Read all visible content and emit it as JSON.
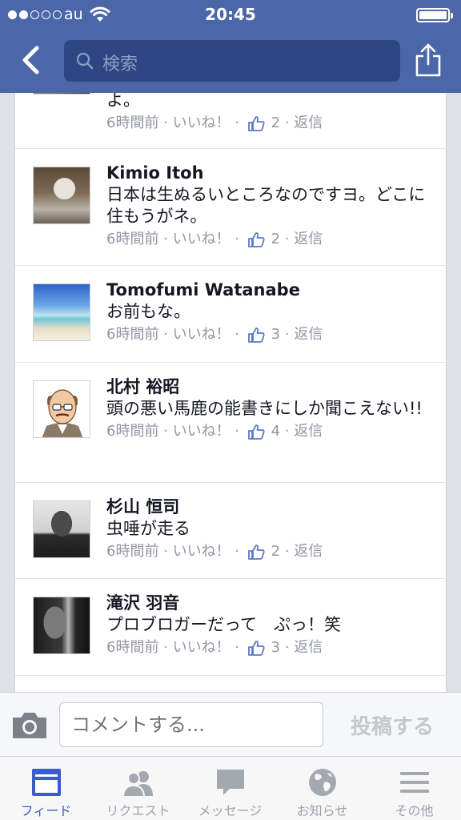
{
  "status_bar": {
    "carrier": "au",
    "time": "20:45"
  },
  "nav": {
    "search_placeholder": "検索"
  },
  "comments": [
    {
      "name": "",
      "text": "よ。",
      "time": "6時間前",
      "like_label": "いいね！",
      "likes": "2",
      "reply_label": "返信"
    },
    {
      "name": "Kimio  Itoh",
      "text": "日本は生ぬるいところなのですヨ。どこに住もうがネ。",
      "time": "6時間前",
      "like_label": "いいね！",
      "likes": "2",
      "reply_label": "返信"
    },
    {
      "name": "Tomofumi Watanabe",
      "text": "お前もな。",
      "time": "6時間前",
      "like_label": "いいね！",
      "likes": "3",
      "reply_label": "返信"
    },
    {
      "name": "北村 裕昭",
      "text": "頭の悪い馬鹿の能書きにしか聞こえない!!",
      "time": "6時間前",
      "like_label": "いいね！",
      "likes": "4",
      "reply_label": "返信"
    },
    {
      "name": "杉山 恒司",
      "text": "虫唾が走る",
      "time": "6時間前",
      "like_label": "いいね！",
      "likes": "2",
      "reply_label": "返信"
    },
    {
      "name": "滝沢 羽音",
      "text": "プロブロガーだって　ぷっ！笑",
      "time": "6時間前",
      "like_label": "いいね！",
      "likes": "3",
      "reply_label": "返信"
    }
  ],
  "composer": {
    "placeholder": "コメントする...",
    "post_label": "投稿する"
  },
  "tabs": [
    {
      "label": "フィード",
      "icon": "feed-icon",
      "active": true
    },
    {
      "label": "リクエスト",
      "icon": "friend-requests-icon",
      "active": false
    },
    {
      "label": "メッセージ",
      "icon": "messages-icon",
      "active": false
    },
    {
      "label": "お知らせ",
      "icon": "globe-notifications-icon",
      "active": false
    },
    {
      "label": "その他",
      "icon": "menu-icon",
      "active": false
    }
  ],
  "colors": {
    "header": "#4b67a8",
    "search_field": "#2e4784",
    "active_tab": "#3b5ccc",
    "meta_text": "#9197a3"
  }
}
